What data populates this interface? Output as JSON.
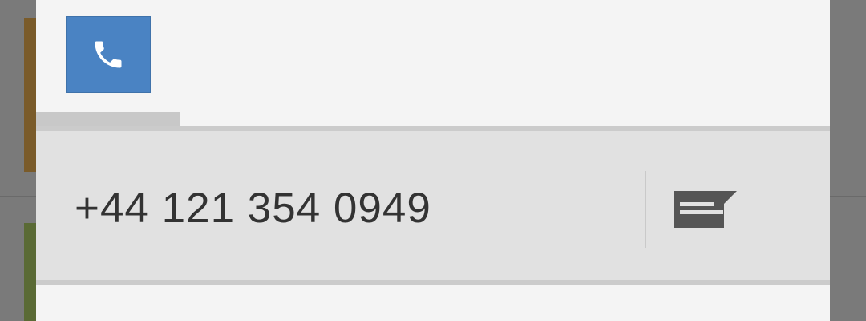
{
  "contact": {
    "phone_number": "+44 121 354 0949",
    "call_icon": "phone-icon",
    "message_icon": "message-icon"
  },
  "colors": {
    "call_button": "#4a83c3",
    "row_background": "#e1e1e1",
    "panel_background": "#f4f4f4",
    "icon_dark": "#555555"
  }
}
